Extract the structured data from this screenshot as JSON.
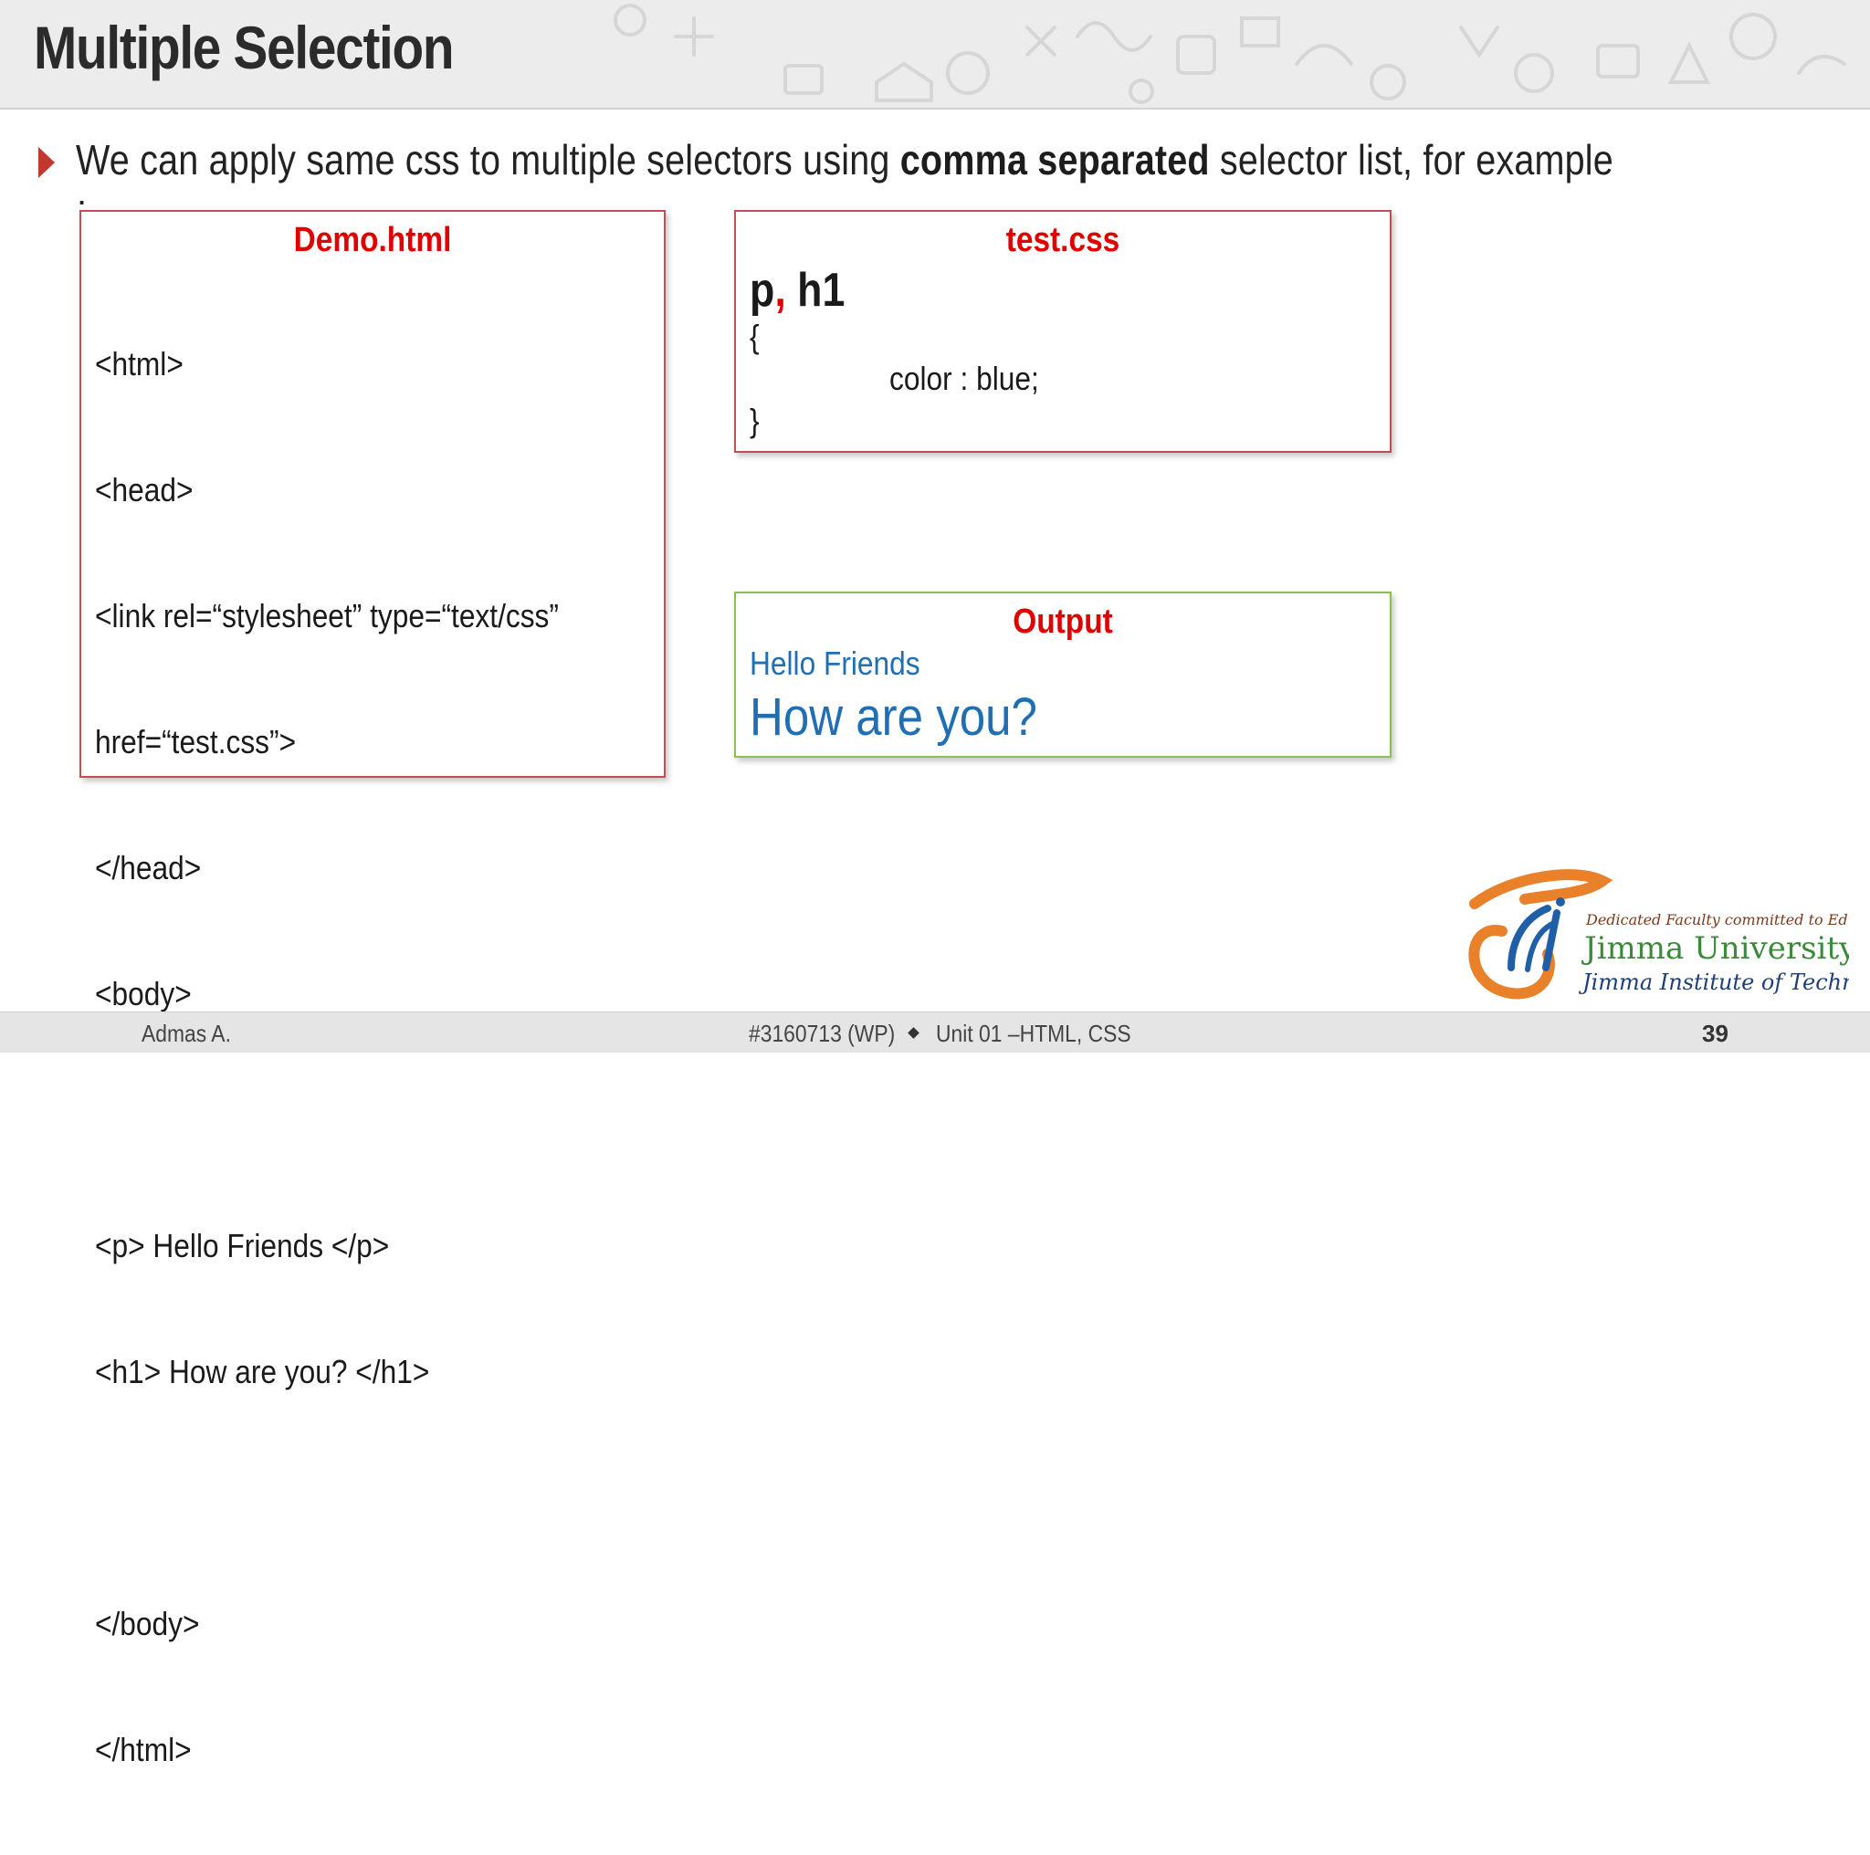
{
  "slide": {
    "title": "Multiple Selection",
    "bullet": {
      "text_before": "We can apply same css to multiple selectors using ",
      "bold": "comma separated",
      "text_after": " selector list, for example",
      "trailing": ":"
    }
  },
  "demo_box": {
    "title": "Demo.html",
    "lines": [
      "<html>",
      "<head>",
      "<link rel=“stylesheet” type=“text/css”",
      "href=“test.css”>",
      "</head>",
      "<body>",
      "",
      "<p> Hello Friends </p>",
      "<h1> How are you? </h1>",
      "",
      "</body>",
      "</html>"
    ]
  },
  "css_box": {
    "title": "test.css",
    "selector_p": "p",
    "comma": ",",
    "selector_h1": " h1",
    "open_brace": "{",
    "declaration": "color : blue;",
    "close_brace": "}"
  },
  "output_box": {
    "title": "Output",
    "paragraph": "Hello Friends",
    "heading": "How are you?",
    "text_color": "#1f6fb2"
  },
  "logo": {
    "tagline": "Dedicated Faculty committed to Education",
    "name": "Jimma University",
    "subtitle": "Jimma Institute of Technology",
    "monogram": "JiT"
  },
  "footer": {
    "author": "Admas A.",
    "course": "#3160713 (WP)",
    "unit": "Unit 01 –HTML, CSS",
    "page": "39"
  },
  "colors": {
    "accent_red": "#e00000",
    "bullet_red": "#c0392b",
    "box_border_red": "#c0504d",
    "box_border_green": "#8cc152",
    "logo_orange": "#e8812a",
    "logo_blue": "#1f5fa8",
    "logo_green": "#3a8a3a"
  }
}
